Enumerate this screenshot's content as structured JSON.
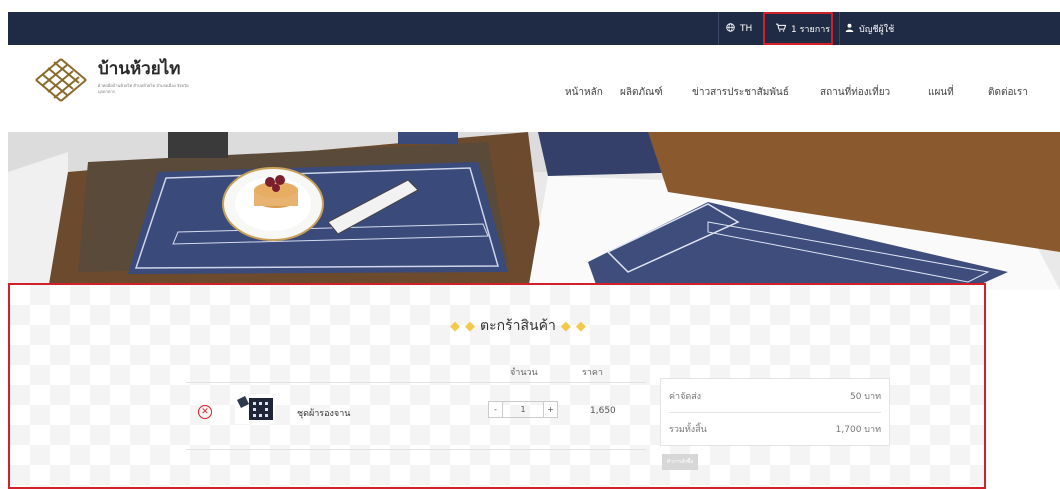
{
  "topbar": {
    "language": "TH",
    "cart_label": "1 รายการ",
    "account_label": "บัญชีผู้ใช้"
  },
  "brand": {
    "name": "บ้านห้วยไท",
    "subtitle": "ผ้าทอมือบ้านห้วยไท ตำบลห้วยไท อำเภอเมือง จังหวัดมุกดาหาร"
  },
  "nav": {
    "items": [
      "หน้าหลัก",
      "ผลิตภัณฑ์",
      "ข่าวสารประชาสัมพันธ์",
      "สถานที่ท่องเที่ยว",
      "แผนที่",
      "ติดต่อเรา"
    ]
  },
  "cart": {
    "title": "ตะกร้าสินค้า",
    "col_qty": "จำนวน",
    "col_price": "ราคา",
    "items": [
      {
        "name": "ชุดผ้ารองจาน",
        "qty": "1",
        "price": "1,650",
        "minus": "-",
        "plus": "+"
      }
    ],
    "summary": {
      "shipping_label": "ค่าจัดส่ง",
      "shipping_value": "50 บาท",
      "total_label": "รวมทั้งสิ้น",
      "total_value": "1,700 บาท"
    },
    "checkout_label": "ทำการสั่งซื้อ"
  },
  "colors": {
    "topbar_bg": "#1f2a44",
    "highlight": "#d2202a",
    "gem": "#f2c94c"
  }
}
